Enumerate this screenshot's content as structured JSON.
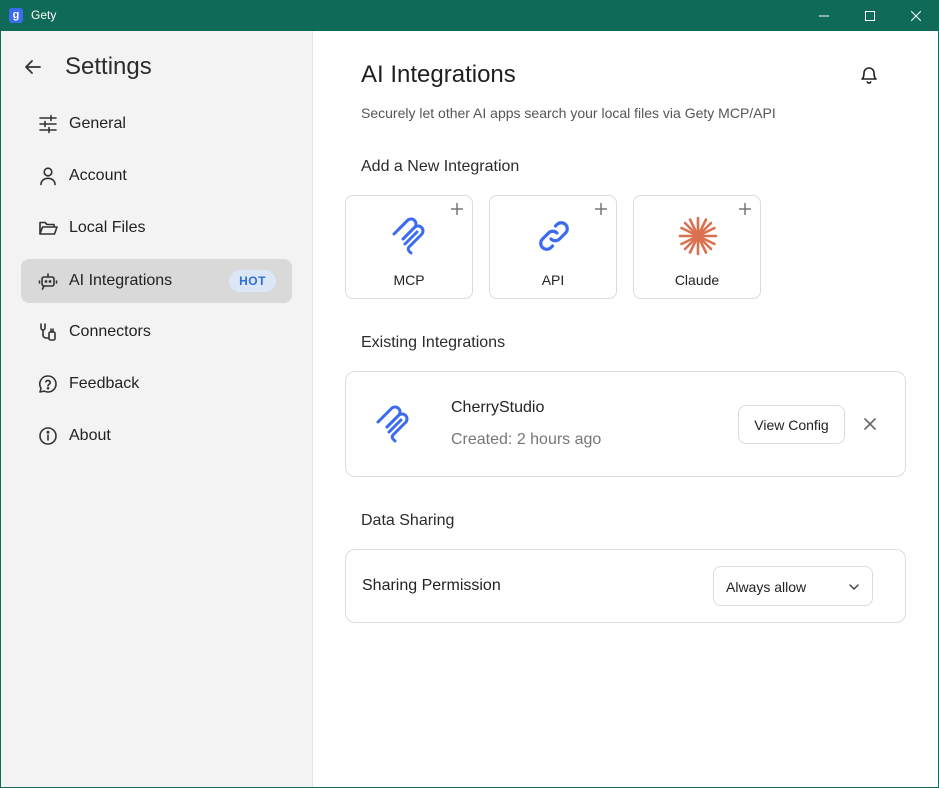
{
  "window": {
    "app_name": "Gety",
    "logo_glyph": "g"
  },
  "sidebar": {
    "title": "Settings",
    "items": [
      {
        "label": "General",
        "icon": "sliders-icon"
      },
      {
        "label": "Account",
        "icon": "user-icon"
      },
      {
        "label": "Local Files",
        "icon": "folder-open-icon"
      },
      {
        "label": "AI Integrations",
        "icon": "bot-icon",
        "badge": "HOT",
        "active": true
      },
      {
        "label": "Connectors",
        "icon": "connectors-icon"
      },
      {
        "label": "Feedback",
        "icon": "message-question-icon"
      },
      {
        "label": "About",
        "icon": "info-icon"
      }
    ]
  },
  "main": {
    "title": "AI Integrations",
    "subtitle": "Securely let other AI apps search your local files via Gety MCP/API",
    "add_section": {
      "heading": "Add a New Integration",
      "cards": [
        {
          "label": "MCP",
          "icon": "mcp-icon"
        },
        {
          "label": "API",
          "icon": "link-icon"
        },
        {
          "label": "Claude",
          "icon": "claude-starburst-icon"
        }
      ]
    },
    "existing_section": {
      "heading": "Existing Integrations",
      "items": [
        {
          "name": "CherryStudio",
          "created": "Created: 2 hours ago",
          "action_label": "View Config"
        }
      ]
    },
    "sharing_section": {
      "heading": "Data Sharing",
      "label": "Sharing Permission",
      "selected": "Always allow"
    }
  },
  "colors": {
    "titlebar": "#0f6b57",
    "accent_blue": "#3b6cf0",
    "claude_orange": "#d9714f",
    "badge_bg": "#dbe7f6",
    "badge_text": "#2f6fd6"
  }
}
